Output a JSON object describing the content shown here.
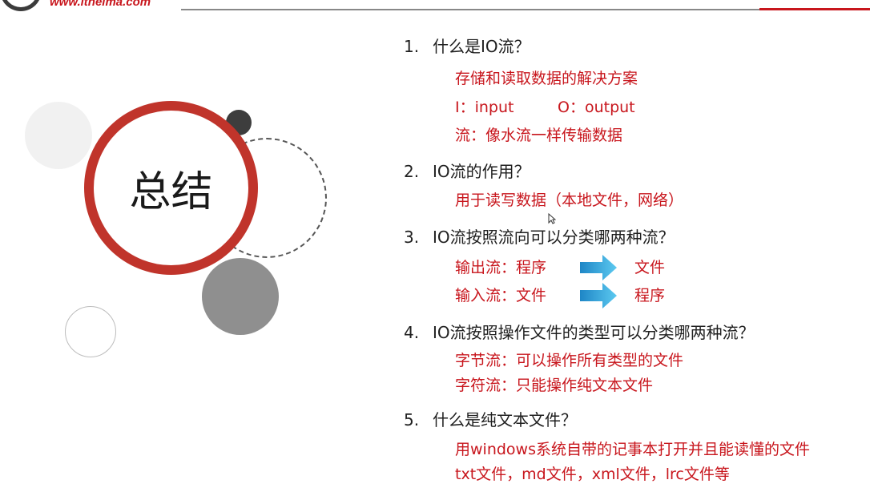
{
  "header": {
    "site_url": "www.itheima.com"
  },
  "title": "总结",
  "questions": [
    {
      "num": "1.",
      "text": "什么是IO流？",
      "answers": [
        "存储和读取数据的解决方案",
        "I：input",
        "O：output",
        "流：像水流一样传输数据"
      ]
    },
    {
      "num": "2.",
      "text": "IO流的作用？",
      "answers": [
        "用于读写数据（本地文件，网络）"
      ]
    },
    {
      "num": "3.",
      "text": "IO流按照流向可以分类哪两种流？",
      "flows": [
        {
          "label": "输出流：程序",
          "target": "文件"
        },
        {
          "label": "输入流：文件",
          "target": "程序"
        }
      ]
    },
    {
      "num": "4.",
      "text": "IO流按照操作文件的类型可以分类哪两种流？",
      "answers": [
        "字节流：可以操作所有类型的文件",
        "字符流：只能操作纯文本文件"
      ]
    },
    {
      "num": "5.",
      "text": "什么是纯文本文件？",
      "answers": [
        "用windows系统自带的记事本打开并且能读懂的文件",
        "txt文件，md文件，xml文件，lrc文件等"
      ]
    }
  ],
  "colors": {
    "accent_red": "#c8161d",
    "ring_red": "#c0342b",
    "arrow_blue": "#2a9fd6"
  },
  "icons": {
    "flow_arrow": "arrow-right-icon",
    "cursor": "mouse-pointer-icon"
  }
}
